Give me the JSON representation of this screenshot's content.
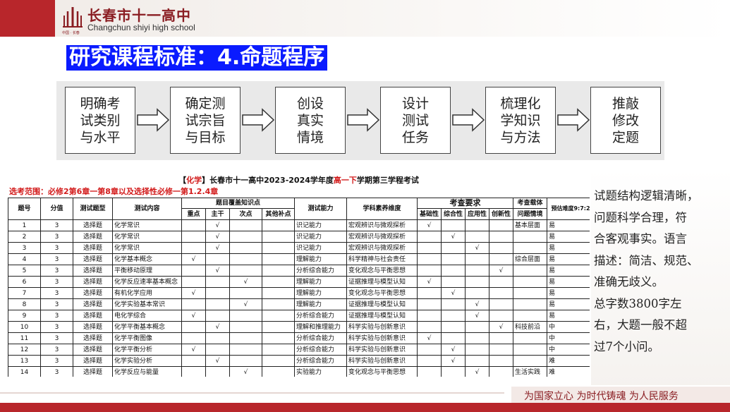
{
  "header": {
    "school_cn": "长春市十一高中",
    "school_en": "Changchun shiyi high school",
    "logo_sub": "中国 · 长春"
  },
  "title": "研究课程标准：4.命题程序",
  "flow": {
    "steps": [
      "明确考\n试类别\n与水平",
      "确定测\n试宗旨\n与目标",
      "创设\n真实\n情境",
      "设计\n测试\n任务",
      "梳理化\n学知识\n与方法",
      "推敲\n修改\n定题"
    ]
  },
  "table": {
    "title_prefix": "【",
    "title_subject": "化学",
    "title_mid": "】长春市十一高中2023-2024学年度",
    "title_grade": "高一下",
    "title_suffix": "学期第三学程考试",
    "scope": "选考范围：必修2第6章一第8章以及选择性必修一第1.2.4章",
    "headers": {
      "no": "题号",
      "score": "分值",
      "type": "测试题型",
      "content": "测试内容",
      "coverage": "题目覆盖知识点",
      "key": "重点",
      "main": "主干",
      "secondary": "次点",
      "other": "其他补点",
      "ability": "测试能力",
      "literacy": "学科素养维度",
      "requirements": "考查要求",
      "basic": "基础性",
      "comprehensive": "综合性",
      "applied": "应用性",
      "innovative": "创新性",
      "carrier": "考查载体",
      "situation": "问题情境",
      "difficulty": "预估难度9:7:2"
    },
    "rows": [
      {
        "no": "1",
        "score": "3",
        "type": "选择题",
        "content": "化学常识",
        "key": "",
        "main": "√",
        "secondary": "",
        "other": "",
        "ability": "识记能力",
        "literacy": "宏观辨识与微观探析",
        "basic": "√",
        "comp": "",
        "app": "",
        "innov": "",
        "carrier": "基本层面",
        "diff": "易"
      },
      {
        "no": "2",
        "score": "3",
        "type": "选择题",
        "content": "化学常识",
        "key": "",
        "main": "√",
        "secondary": "",
        "other": "",
        "ability": "识记能力",
        "literacy": "宏观辨识与微观探析",
        "basic": "",
        "comp": "√",
        "app": "",
        "innov": "",
        "carrier": "",
        "diff": "易"
      },
      {
        "no": "3",
        "score": "3",
        "type": "选择题",
        "content": "化学常识",
        "key": "",
        "main": "√",
        "secondary": "",
        "other": "",
        "ability": "识记能力",
        "literacy": "宏观辨识与微观探析",
        "basic": "",
        "comp": "",
        "app": "√",
        "innov": "",
        "carrier": "",
        "diff": "易"
      },
      {
        "no": "4",
        "score": "3",
        "type": "选择题",
        "content": "化学基本概念",
        "key": "√",
        "main": "",
        "secondary": "",
        "other": "",
        "ability": "理解能力",
        "literacy": "科学精神与社会责任",
        "basic": "",
        "comp": "",
        "app": "",
        "innov": "",
        "carrier": "综合层面",
        "diff": "易"
      },
      {
        "no": "5",
        "score": "3",
        "type": "选择题",
        "content": "平衡移动原理",
        "key": "",
        "main": "√",
        "secondary": "",
        "other": "",
        "ability": "分析综合能力",
        "literacy": "变化观念与平衡思想",
        "basic": "",
        "comp": "",
        "app": "",
        "innov": "√",
        "carrier": "",
        "diff": "易"
      },
      {
        "no": "6",
        "score": "3",
        "type": "选择题",
        "content": "化学反应速率基本概念",
        "key": "",
        "main": "",
        "secondary": "√",
        "other": "",
        "ability": "理解能力",
        "literacy": "证据推理与模型认知",
        "basic": "√",
        "comp": "",
        "app": "",
        "innov": "",
        "carrier": "",
        "diff": "易"
      },
      {
        "no": "7",
        "score": "3",
        "type": "选择题",
        "content": "有机化学应用",
        "key": "√",
        "main": "",
        "secondary": "",
        "other": "",
        "ability": "理解能力",
        "literacy": "变化观念与平衡思想",
        "basic": "",
        "comp": "√",
        "app": "",
        "innov": "",
        "carrier": "",
        "diff": "易"
      },
      {
        "no": "8",
        "score": "3",
        "type": "选择题",
        "content": "化学实验基本常识",
        "key": "",
        "main": "",
        "secondary": "√",
        "other": "",
        "ability": "理解能力",
        "literacy": "证据推理与模型认知",
        "basic": "",
        "comp": "",
        "app": "√",
        "innov": "",
        "carrier": "",
        "diff": "易"
      },
      {
        "no": "9",
        "score": "3",
        "type": "选择题",
        "content": "电化学综合",
        "key": "√",
        "main": "",
        "secondary": "",
        "other": "",
        "ability": "分析综合能力",
        "literacy": "证据推理与模型认知",
        "basic": "",
        "comp": "",
        "app": "√",
        "innov": "",
        "carrier": "",
        "diff": "易"
      },
      {
        "no": "10",
        "score": "3",
        "type": "选择题",
        "content": "化学平衡基本概念",
        "key": "",
        "main": "√",
        "secondary": "",
        "other": "",
        "ability": "理解和推理能力",
        "literacy": "科学实验与创新意识",
        "basic": "",
        "comp": "",
        "app": "",
        "innov": "√",
        "carrier": "科技前沿",
        "diff": "中"
      },
      {
        "no": "11",
        "score": "3",
        "type": "选择题",
        "content": "化学平衡图像",
        "key": "",
        "main": "",
        "secondary": "",
        "other": "",
        "ability": "分析综合能力",
        "literacy": "科学实验与创新意识",
        "basic": "√",
        "comp": "",
        "app": "",
        "innov": "",
        "carrier": "",
        "diff": "中"
      },
      {
        "no": "12",
        "score": "3",
        "type": "选择题",
        "content": "化学平衡分析",
        "key": "√",
        "main": "",
        "secondary": "",
        "other": "",
        "ability": "分析综合能力",
        "literacy": "科学实验与创新意识",
        "basic": "",
        "comp": "√",
        "app": "",
        "innov": "",
        "carrier": "",
        "diff": "中"
      },
      {
        "no": "13",
        "score": "3",
        "type": "选择题",
        "content": "化学实验分析",
        "key": "",
        "main": "√",
        "secondary": "",
        "other": "",
        "ability": "分析综合能力",
        "literacy": "科学实验与创新意识",
        "basic": "",
        "comp": "√",
        "app": "",
        "innov": "",
        "carrier": "",
        "diff": "难"
      },
      {
        "no": "14",
        "score": "3",
        "type": "选择题",
        "content": "化学反应与能量",
        "key": "",
        "main": "",
        "secondary": "√",
        "other": "",
        "ability": "实验能力",
        "literacy": "变化观念与平衡思想",
        "basic": "",
        "comp": "",
        "app": "√",
        "innov": "",
        "carrier": "生活实践",
        "diff": "难"
      }
    ]
  },
  "side_text": [
    "试题结构逻辑清晰，",
    "问题科学合理，符",
    "合客观事实。语言",
    "描述：简洁、规范、",
    "准确无歧义。",
    "总字数3800字左",
    "右，大题一般不超",
    "过7个小问。"
  ],
  "footer": {
    "slogan": "为国家立心  为时代铸魂  为人民服务"
  },
  "colors": {
    "brand_red": "#b8262b",
    "title_blue": "#0a1bff",
    "scope_red": "#d21a1a"
  }
}
